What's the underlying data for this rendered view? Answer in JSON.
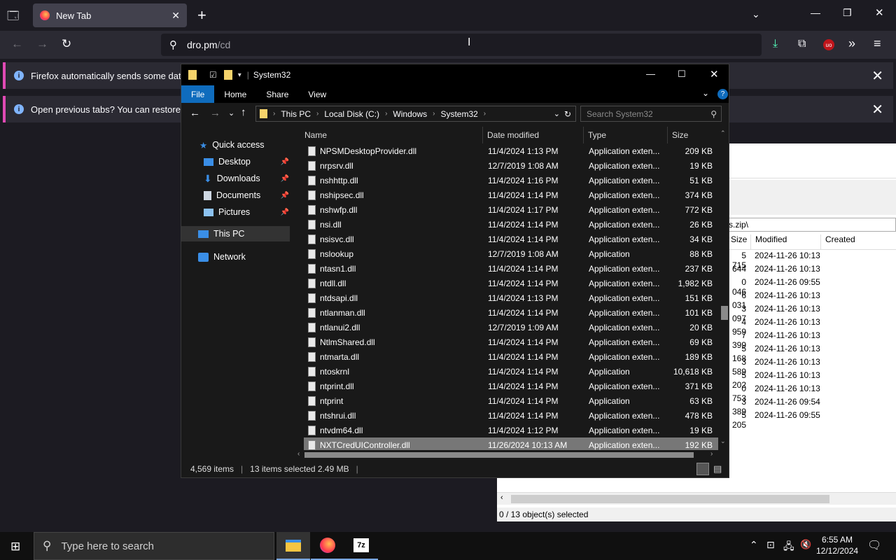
{
  "browser": {
    "tab_title": "New Tab",
    "url": "dro.pm",
    "url_path": "/cd",
    "notification1": "Firefox automatically sends some data to",
    "notification2": "Open previous tabs? You can restore your"
  },
  "explorer": {
    "title": "System32",
    "ribbon_tabs": [
      "File",
      "Home",
      "Share",
      "View"
    ],
    "breadcrumb": [
      "This PC",
      "Local Disk (C:)",
      "Windows",
      "System32"
    ],
    "search_placeholder": "Search System32",
    "nav": [
      "Quick access",
      "Desktop",
      "Downloads",
      "Documents",
      "Pictures",
      "This PC",
      "Network"
    ],
    "columns": {
      "name": "Name",
      "date": "Date modified",
      "type": "Type",
      "size": "Size"
    },
    "files": [
      {
        "name": "NPSMDesktopProvider.dll",
        "date": "11/4/2024 1:13 PM",
        "type": "Application exten...",
        "size": "209 KB"
      },
      {
        "name": "nrpsrv.dll",
        "date": "12/7/2019 1:08 AM",
        "type": "Application exten...",
        "size": "19 KB"
      },
      {
        "name": "nshhttp.dll",
        "date": "11/4/2024 1:16 PM",
        "type": "Application exten...",
        "size": "51 KB"
      },
      {
        "name": "nshipsec.dll",
        "date": "11/4/2024 1:14 PM",
        "type": "Application exten...",
        "size": "374 KB"
      },
      {
        "name": "nshwfp.dll",
        "date": "11/4/2024 1:17 PM",
        "type": "Application exten...",
        "size": "772 KB"
      },
      {
        "name": "nsi.dll",
        "date": "11/4/2024 1:14 PM",
        "type": "Application exten...",
        "size": "26 KB"
      },
      {
        "name": "nsisvc.dll",
        "date": "11/4/2024 1:14 PM",
        "type": "Application exten...",
        "size": "34 KB"
      },
      {
        "name": "nslookup",
        "date": "12/7/2019 1:08 AM",
        "type": "Application",
        "size": "88 KB"
      },
      {
        "name": "ntasn1.dll",
        "date": "11/4/2024 1:14 PM",
        "type": "Application exten...",
        "size": "237 KB"
      },
      {
        "name": "ntdll.dll",
        "date": "11/4/2024 1:14 PM",
        "type": "Application exten...",
        "size": "1,982 KB"
      },
      {
        "name": "ntdsapi.dll",
        "date": "11/4/2024 1:13 PM",
        "type": "Application exten...",
        "size": "151 KB"
      },
      {
        "name": "ntlanman.dll",
        "date": "11/4/2024 1:14 PM",
        "type": "Application exten...",
        "size": "101 KB"
      },
      {
        "name": "ntlanui2.dll",
        "date": "12/7/2019 1:09 AM",
        "type": "Application exten...",
        "size": "20 KB"
      },
      {
        "name": "NtlmShared.dll",
        "date": "11/4/2024 1:14 PM",
        "type": "Application exten...",
        "size": "69 KB"
      },
      {
        "name": "ntmarta.dll",
        "date": "11/4/2024 1:14 PM",
        "type": "Application exten...",
        "size": "189 KB"
      },
      {
        "name": "ntoskrnl",
        "date": "11/4/2024 1:14 PM",
        "type": "Application",
        "size": "10,618 KB"
      },
      {
        "name": "ntprint.dll",
        "date": "11/4/2024 1:14 PM",
        "type": "Application exten...",
        "size": "371 KB"
      },
      {
        "name": "ntprint",
        "date": "11/4/2024 1:14 PM",
        "type": "Application",
        "size": "63 KB"
      },
      {
        "name": "ntshrui.dll",
        "date": "11/4/2024 1:14 PM",
        "type": "Application exten...",
        "size": "478 KB"
      },
      {
        "name": "ntvdm64.dll",
        "date": "11/4/2024 1:12 PM",
        "type": "Application exten...",
        "size": "19 KB"
      },
      {
        "name": "NXTCredUIController.dll",
        "date": "11/26/2024 10:13 AM",
        "type": "Application exten...",
        "size": "192 KB"
      }
    ],
    "status_count": "4,569 items",
    "status_selected": "13 items selected  2.49 MB"
  },
  "sevenzip": {
    "path_fragment": "s.zip\\",
    "columns": {
      "size": "Size",
      "modified": "Modified",
      "created": "Created"
    },
    "rows": [
      {
        "size": "5 715",
        "modified": "2024-11-26 10:13"
      },
      {
        "size": "644",
        "modified": "2024-11-26 10:13"
      },
      {
        "size": "0 046",
        "modified": "2024-11-26 09:55"
      },
      {
        "size": "6 031",
        "modified": "2024-11-26 10:13"
      },
      {
        "size": "3 097",
        "modified": "2024-11-26 10:13"
      },
      {
        "size": "4 959",
        "modified": "2024-11-26 10:13"
      },
      {
        "size": "7 399",
        "modified": "2024-11-26 10:13"
      },
      {
        "size": "5 168",
        "modified": "2024-11-26 10:13"
      },
      {
        "size": "3 589",
        "modified": "2024-11-26 10:13"
      },
      {
        "size": "5 202",
        "modified": "2024-11-26 10:13"
      },
      {
        "size": "0 753",
        "modified": "2024-11-26 10:13"
      },
      {
        "size": "3 389",
        "modified": "2024-11-26 09:54"
      },
      {
        "size": "5 205",
        "modified": "2024-11-26 09:55"
      }
    ],
    "status": "0 / 13 object(s) selected"
  },
  "taskbar": {
    "search_placeholder": "Type here to search",
    "time": "6:55 AM",
    "date": "12/12/2024",
    "sevenzip_label": "7z"
  }
}
